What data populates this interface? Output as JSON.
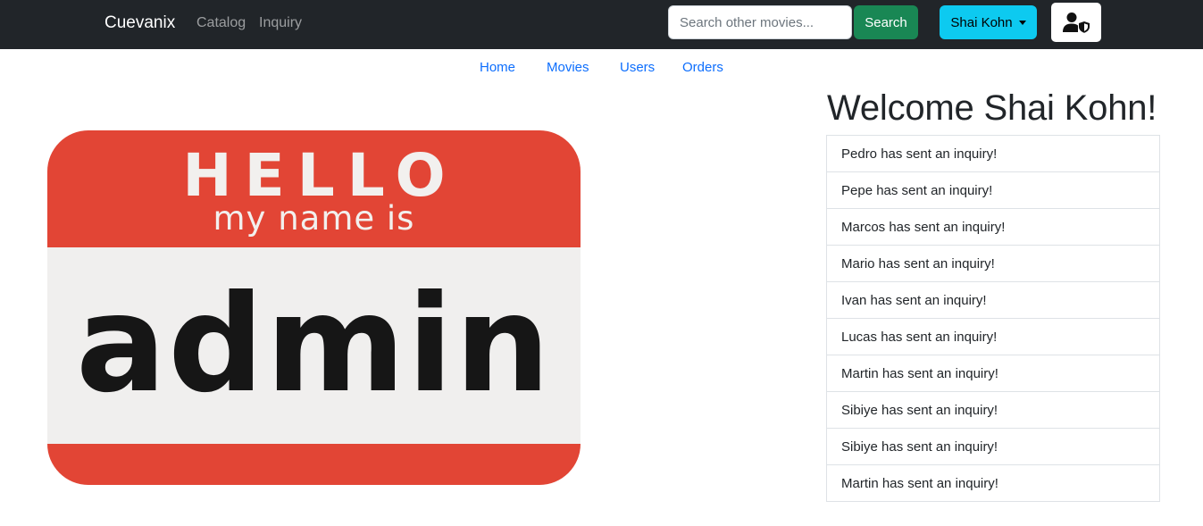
{
  "navbar": {
    "brand": "Cuevanix",
    "links": [
      "Catalog",
      "Inquiry"
    ],
    "search": {
      "placeholder": "Search other movies...",
      "value": "",
      "button_label": "Search"
    },
    "user_menu": {
      "label": "Shai Kohn"
    },
    "admin_icon": "user-shield-icon"
  },
  "subnav": {
    "links": [
      "Home",
      "Movies",
      "Users",
      "Orders"
    ]
  },
  "image": {
    "hello": "HELLO",
    "subtitle": "my name is",
    "name": "admin"
  },
  "welcome": "Welcome Shai Kohn!",
  "inquiries": [
    "Pedro has sent an inquiry!",
    "Pepe has sent an inquiry!",
    "Marcos has sent an inquiry!",
    "Mario has sent an inquiry!",
    "Ivan has sent an inquiry!",
    "Lucas has sent an inquiry!",
    "Martin has sent an inquiry!",
    "Sibiye has sent an inquiry!",
    "Sibiye has sent an inquiry!",
    "Martin has sent an inquiry!"
  ],
  "colors": {
    "navbar_bg": "#212529",
    "search_button": "#198754",
    "user_button": "#0dcaf0",
    "link": "#0d6efd",
    "hello_red": "#e24535"
  }
}
